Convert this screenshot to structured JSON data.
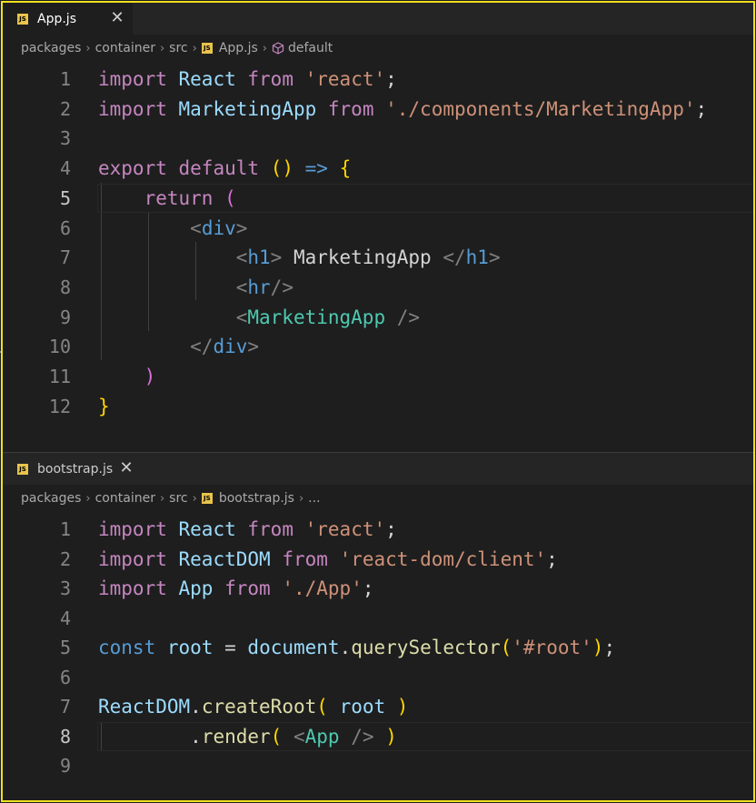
{
  "pane1": {
    "tab": {
      "icon": "JS",
      "label": "App.js",
      "close": "✕"
    },
    "breadcrumb": {
      "items": [
        "packages",
        "container",
        "src",
        "App.js",
        "default"
      ],
      "sep": "›"
    },
    "lines": [
      {
        "n": "1",
        "code": "import React from 'react';"
      },
      {
        "n": "2",
        "code": "import MarketingApp from './components/MarketingApp';"
      },
      {
        "n": "3",
        "code": ""
      },
      {
        "n": "4",
        "code": "export default () => {"
      },
      {
        "n": "5",
        "code": "    return ("
      },
      {
        "n": "6",
        "code": "        <div>"
      },
      {
        "n": "7",
        "code": "            <h1> MarketingApp </h1>"
      },
      {
        "n": "8",
        "code": "            <hr/>"
      },
      {
        "n": "9",
        "code": "            <MarketingApp />"
      },
      {
        "n": "10",
        "code": "        </div>"
      },
      {
        "n": "11",
        "code": "    )"
      },
      {
        "n": "12",
        "code": "}"
      }
    ],
    "active_line": "5"
  },
  "pane2": {
    "tab": {
      "icon": "JS",
      "label": "bootstrap.js",
      "close": "✕"
    },
    "breadcrumb": {
      "items": [
        "packages",
        "container",
        "src",
        "bootstrap.js",
        "..."
      ],
      "sep": "›"
    },
    "lines": [
      {
        "n": "1",
        "code": "import React from 'react';"
      },
      {
        "n": "2",
        "code": "import ReactDOM from 'react-dom/client';"
      },
      {
        "n": "3",
        "code": "import App from './App';"
      },
      {
        "n": "4",
        "code": ""
      },
      {
        "n": "5",
        "code": "const root = document.querySelector('#root');"
      },
      {
        "n": "6",
        "code": ""
      },
      {
        "n": "7",
        "code": "ReactDOM.createRoot( root )"
      },
      {
        "n": "8",
        "code": "        .render( <App /> )"
      },
      {
        "n": "9",
        "code": ""
      }
    ],
    "active_line": "8"
  },
  "colors": {
    "highlight_border": "#f0e020",
    "keyword_control": "#c586c0",
    "keyword": "#569cd6",
    "variable": "#9cdcfe",
    "string": "#ce9178",
    "function": "#dcdcaa",
    "component": "#4ec9b0",
    "bracket_gold": "#ffd700",
    "bracket_orchid": "#da70d6",
    "bracket_blue": "#179fff"
  }
}
